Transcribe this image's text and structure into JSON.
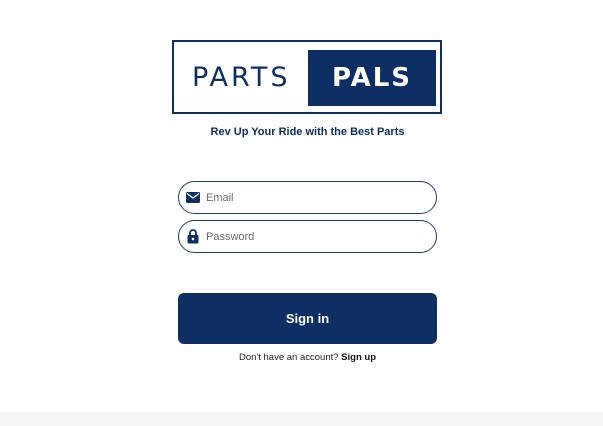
{
  "brand": {
    "logo_left": "PARTS",
    "logo_right": "PALS",
    "tagline": "Rev Up Your Ride with the Best Parts"
  },
  "form": {
    "email": {
      "placeholder": "Email",
      "value": "",
      "icon": "mail-icon"
    },
    "password": {
      "placeholder": "Password",
      "value": "",
      "icon": "lock-icon"
    },
    "signin_label": "Sign in"
  },
  "signup": {
    "prompt": "Don't have an account?",
    "link_label": "Sign up"
  },
  "colors": {
    "brand_navy": "#0d2f63",
    "field_border": "#1d3f74",
    "background": "#ffffff"
  }
}
